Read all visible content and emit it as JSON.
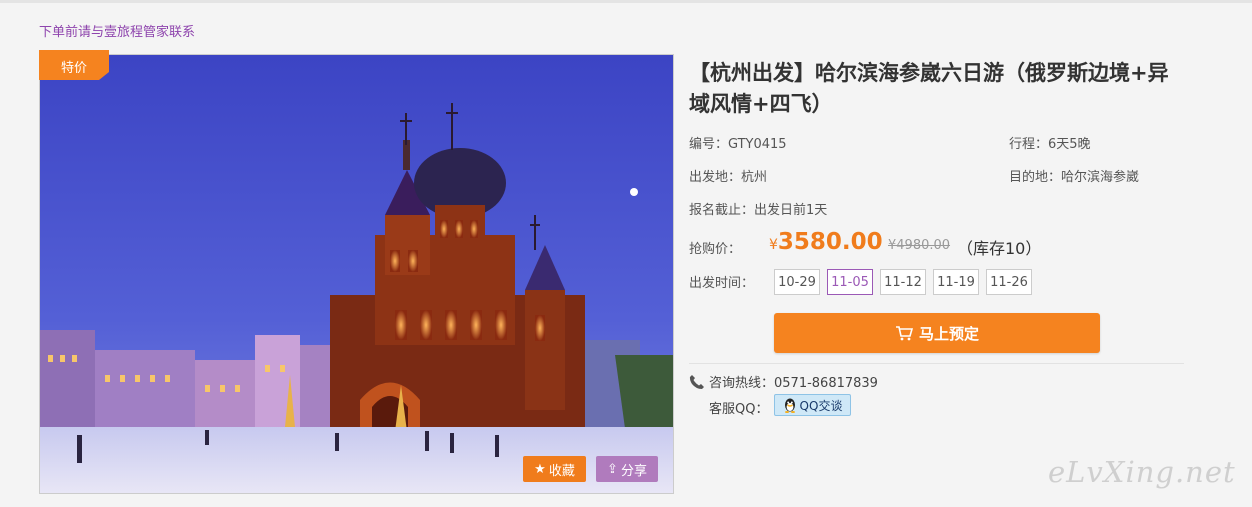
{
  "notice": "下单前请与壹旅程管家联系",
  "badge": "特价",
  "image_buttons": {
    "favorite": "收藏",
    "share": "分享"
  },
  "product": {
    "title": "【杭州出发】哈尔滨海参崴六日游（俄罗斯边境+异域风情+四飞）",
    "code": "编号：GTY0415",
    "duration": "行程：6天5晚",
    "departure": "出发地：杭州",
    "destination": "目的地：哈尔滨海参崴",
    "deadline": "报名截止：出发日前1天"
  },
  "price": {
    "label": "抢购价：",
    "currency": "¥",
    "current": "3580.00",
    "original": "¥4980.00",
    "stock": "（库存10）"
  },
  "dates": {
    "label": "出发时间：",
    "options": [
      "10-29",
      "11-05",
      "11-12",
      "11-19",
      "11-26"
    ],
    "selected": "11-05"
  },
  "book_button": "马上预定",
  "contact": {
    "hotline": "咨询热线：0571-86817839",
    "qq_label": "客服QQ：",
    "qq_button": "QQ交谈"
  },
  "watermark": "eLvXing.net",
  "colors": {
    "accent": "#f5831f",
    "selected": "#9b59b6",
    "share": "#b07bbd"
  }
}
